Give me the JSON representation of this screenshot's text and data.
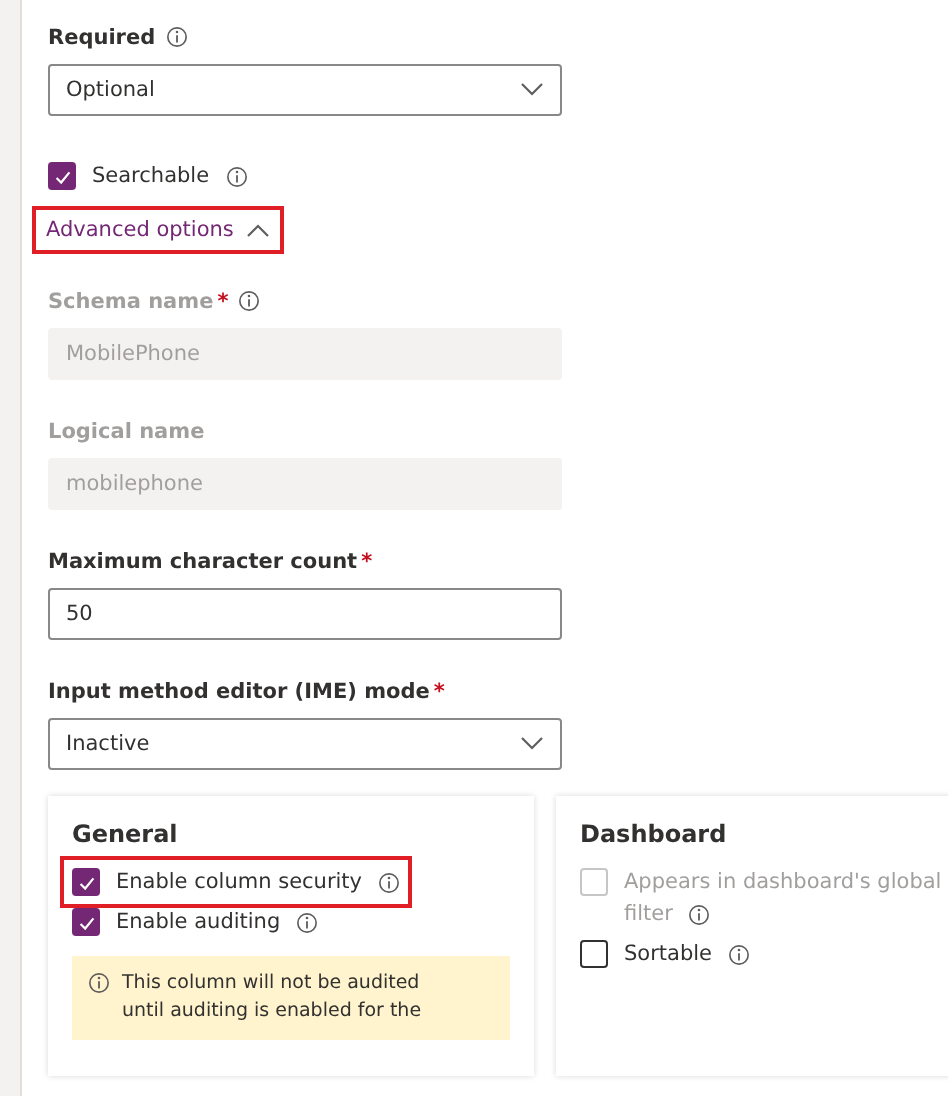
{
  "required": {
    "label": "Required",
    "info": true,
    "value": "Optional"
  },
  "searchable": {
    "label": "Searchable",
    "checked": true,
    "info": true
  },
  "advanced_options": {
    "label": "Advanced options",
    "expanded": true,
    "highlighted": true
  },
  "fields": [
    {
      "kind": "text",
      "label": "Schema name",
      "required_mark": "*",
      "info": true,
      "value": "MobilePhone",
      "disabled": true
    },
    {
      "kind": "text",
      "label": "Logical name",
      "value": "mobilephone",
      "disabled": true
    },
    {
      "kind": "text",
      "label": "Maximum character count",
      "required_mark": "*",
      "value": "50",
      "disabled": false
    },
    {
      "kind": "dropdown",
      "label": "Input method editor (IME) mode",
      "required_mark": "*",
      "value": "Inactive"
    }
  ],
  "general": {
    "title": "General",
    "options": [
      {
        "label": "Enable column security",
        "checked": true,
        "info": true,
        "highlighted": true
      },
      {
        "label": "Enable auditing",
        "checked": true,
        "info": true
      }
    ],
    "notice": "This column will not be audited until auditing is enabled for the"
  },
  "dashboard": {
    "title": "Dashboard",
    "options": [
      {
        "label_lines": [
          "Appears in dashboard's global",
          "filter"
        ],
        "checked": false,
        "disabled": true,
        "info": true
      },
      {
        "label_lines": [
          "Sortable"
        ],
        "checked": false,
        "disabled": false,
        "info": true
      }
    ]
  }
}
